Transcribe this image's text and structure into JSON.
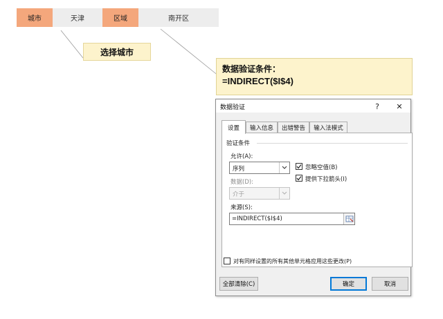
{
  "top_row": {
    "cell1": "城市",
    "cell2": "天津",
    "cell3": "区域",
    "cell4": "南开区"
  },
  "callout_label": "选择城市",
  "note": {
    "line1": "数据验证条件：",
    "line2": "=INDIRECT($I$4)"
  },
  "dialog": {
    "title": "数据验证",
    "help": "?",
    "close": "✕",
    "tabs": [
      "设置",
      "输入信息",
      "出错警告",
      "输入法模式"
    ],
    "group_title": "验证条件",
    "allow_label": "允许(A):",
    "allow_value": "序列",
    "data_label": "数据(D):",
    "data_value": "介于",
    "ignore_blank": "忽略空值(B)",
    "dropdown_arrow": "提供下拉箭头(I)",
    "source_label": "来源(S):",
    "source_value": "=INDIRECT($I$4)",
    "apply_all": "对有同样设置的所有其他单元格应用这些更改(P)",
    "clear_all": "全部清除(C)",
    "ok": "确定",
    "cancel": "取消"
  },
  "colors": {
    "orange_cell": "#f4a77c",
    "gray_cell": "#ededed",
    "note_bg": "#fdf3cc",
    "dialog_bg": "#f0f0f0",
    "focus_blue": "#0078d7"
  }
}
